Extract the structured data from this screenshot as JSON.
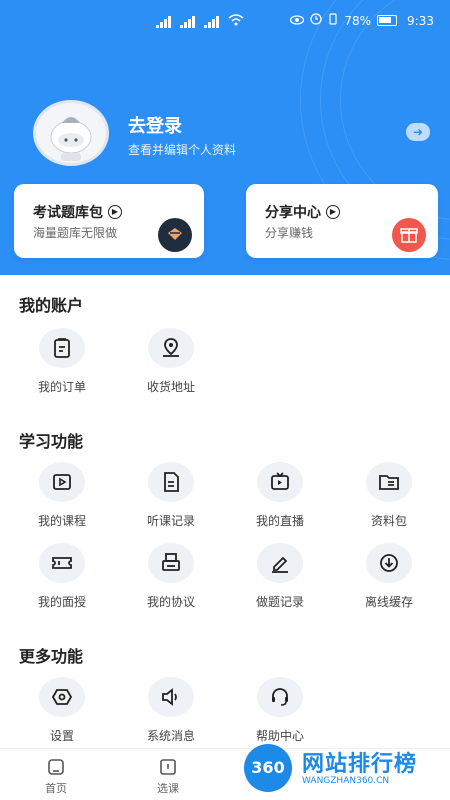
{
  "status_bar": {
    "battery_percent": "78%",
    "time": "9:33"
  },
  "profile": {
    "login_title": "去登录",
    "login_subtitle": "查看并编辑个人资料"
  },
  "cards": [
    {
      "title": "考试题库包",
      "subtitle": "海量题库无限做"
    },
    {
      "title": "分享中心",
      "subtitle": "分享赚钱"
    }
  ],
  "sections": {
    "account": {
      "title": "我的账户",
      "items": [
        {
          "label": "我的订单",
          "icon": "clipboard-icon"
        },
        {
          "label": "收货地址",
          "icon": "location-icon"
        }
      ]
    },
    "study": {
      "title": "学习功能",
      "items": [
        {
          "label": "我的课程",
          "icon": "video-icon"
        },
        {
          "label": "听课记录",
          "icon": "document-icon"
        },
        {
          "label": "我的直播",
          "icon": "live-tv-icon"
        },
        {
          "label": "资料包",
          "icon": "folder-icon"
        },
        {
          "label": "我的面授",
          "icon": "ticket-icon"
        },
        {
          "label": "我的协议",
          "icon": "printer-icon"
        },
        {
          "label": "做题记录",
          "icon": "pencil-icon"
        },
        {
          "label": "离线缓存",
          "icon": "download-icon"
        }
      ]
    },
    "more": {
      "title": "更多功能",
      "items": [
        {
          "label": "设置",
          "icon": "settings-icon"
        },
        {
          "label": "系统消息",
          "icon": "speaker-icon"
        },
        {
          "label": "帮助中心",
          "icon": "headset-icon"
        }
      ]
    }
  },
  "bottom_nav": [
    {
      "label": "首页",
      "icon": "home-icon"
    },
    {
      "label": "选课",
      "icon": "book-icon"
    }
  ],
  "watermark": {
    "badge": "360",
    "text": "网站排行榜",
    "sub": "WANGZHAN360.CN"
  },
  "colors": {
    "header_blue": "#2b8ff5",
    "icon_bg": "#eef1f5",
    "gift_red": "#f2574d"
  }
}
